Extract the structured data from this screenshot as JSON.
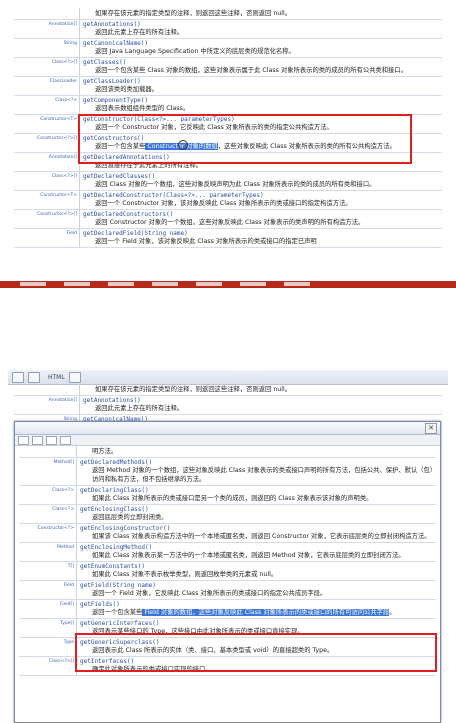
{
  "toolbar": {
    "label": "HTML"
  },
  "shot1": {
    "rows": [
      {
        "mod": "",
        "sig": "",
        "desc": "如果存在该元素的指定类型的注释，则返回这些注释，否则返回 null。"
      },
      {
        "mod": "Annotation[]",
        "sig": "getAnnotations()",
        "desc": "返回此元素上存在的所有注释。"
      },
      {
        "mod": "String",
        "sig": "getCanonicalName()",
        "desc": "返回 Java Language Specification 中所定义的底层类的规范化名称。"
      },
      {
        "mod": "Class<?>[]",
        "sig": "getClasses()",
        "desc": "返回一个包含某些 Class 对象的数组，这些对象表示属于此 Class 对象所表示的类的成员的所有公共类和接口。"
      },
      {
        "mod": "ClassLoader",
        "sig": "getClassLoader()",
        "desc": "返回该类的类加载器。"
      },
      {
        "mod": "Class<?>",
        "sig": "getComponentType()",
        "desc": "返回表示数组组件类型的 Class。"
      },
      {
        "mod": "Constructor<T>",
        "sig": "getConstructor(Class<?>... parameterTypes)",
        "desc": "返回一个 Constructor 对象，它反映此 Class 对象所表示的类的指定公共构造方法。"
      },
      {
        "mod": "Constructor<?>[]",
        "sig": "getConstructors()",
        "descA": "返回一个包含某些",
        "descHL": " Constructor 对象的数组",
        "descB": "，这些对象反映此 Class 对象所表示的类的所有公共构造方法。"
      },
      {
        "mod": "Annotation[]",
        "sig": "getDeclaredAnnotations()",
        "desc": "返回直接存在于此元素上的所有注释。"
      },
      {
        "mod": "Class<?>[]",
        "sig": "getDeclaredClasses()",
        "desc": "返回 Class 对象的一个数组，这些对象反映声明为此 Class 对象所表示的类的成员的所有类和接口。"
      },
      {
        "mod": "Constructor<T>",
        "sig": "getDeclaredConstructor(Class<?>... parameterTypes)",
        "desc": "返回一个 Constructor 对象，该对象反映此 Class 对象所表示的类或接口的指定构造方法。"
      },
      {
        "mod": "Constructor<?>[]",
        "sig": "getDeclaredConstructors()",
        "desc": "返回 Constructor 对象的一个数组，这些对象反映此 Class 对象表示的类声明的所有构造方法。"
      },
      {
        "mod": "Field",
        "sig": "getDeclaredField(String name)",
        "desc": "返回一个 Field 对象，该对象反映此 Class 对象所表示的类或接口的指定已声明"
      }
    ]
  },
  "shot2": {
    "back_rows": [
      {
        "mod": "",
        "sig": "",
        "desc": "如果存在该元素的指定类型的注释，则返回这些注释，否则返回 null。"
      },
      {
        "mod": "Annotation[]",
        "sig": "getAnnotations()",
        "desc": "返回此元素上存在的所有注释。"
      },
      {
        "mod": "String",
        "sig": "getCanonicalName()",
        "desc": ""
      }
    ],
    "front_rows": [
      {
        "mod": "",
        "sig": "",
        "desc": "明方法。"
      },
      {
        "mod": "Method[]",
        "sig": "getDeclaredMethods()",
        "desc": "返回 Method 对象的一个数组，这些对象反映此 Class 对象表示的类或接口声明的所有方法，包括公共、保护、默认（包）访问和私有方法，但不包括继承的方法。"
      },
      {
        "mod": "Class<?>",
        "sig": "getDeclaringClass()",
        "desc": "如果此 Class 对象所表示的类或接口是另一个类的成员，则返回的 Class 对象表示该对象的声明类。"
      },
      {
        "mod": "Class<?>",
        "sig": "getEnclosingClass()",
        "desc": "返回底层类的立即封闭类。"
      },
      {
        "mod": "Constructor<?>",
        "sig": "getEnclosingConstructor()",
        "desc": "如果该 Class 对象表示构造方法中的一个本地或匿名类，则返回 Constructor 对象，它表示底层类的立即封闭构造方法。"
      },
      {
        "mod": "Method",
        "sig": "getEnclosingMethod()",
        "desc": "如果此 Class 对象表示某一方法中的一个本地或匿名类，则返回 Method 对象，它表示底层类的立即封闭方法。"
      },
      {
        "mod": "T[]",
        "sig": "getEnumConstants()",
        "desc": "如果此 Class 对象不表示枚举类型，则返回枚举类的元素或 null。"
      },
      {
        "mod": "Field",
        "sig": "getField(String name)",
        "desc": "返回一个 Field 对象，它反映此 Class 对象所表示的类或接口的指定公共成员字段。"
      },
      {
        "mod": "Field[]",
        "sig": "getFields()",
        "descA": "返回一个包含某些",
        "descHL": " Field 对象的数组，这些对象反映此 Class 对象所表示的类或接口的所有可访问公共字段",
        "descB": "。"
      },
      {
        "mod": "Type[]",
        "sig": "getGenericInterfaces()",
        "desc": "返回表示某些接口的 Type，这些接口由此对象所表示的类或接口直接实现。"
      },
      {
        "mod": "Type",
        "sig": "getGenericSuperclass()",
        "desc": "返回表示此 Class 所表示的实体（类、接口、基本类型或 void）的直接超类的 Type。"
      },
      {
        "mod": "Class<?>[]",
        "sig": "getInterfaces()",
        "desc": "确定此对象所表示的类或接口实现的接口。"
      }
    ]
  }
}
